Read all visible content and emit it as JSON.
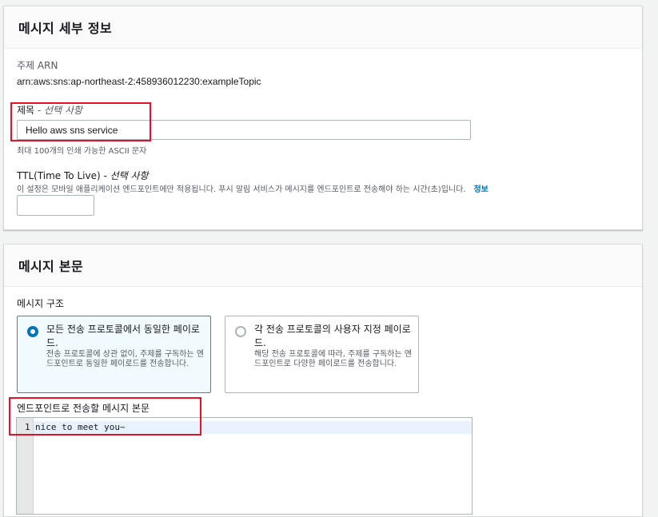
{
  "details": {
    "title": "메시지 세부 정보",
    "topic_arn_label": "주제 ARN",
    "topic_arn_value": "arn:aws:sns:ap-northeast-2:458936012230:exampleTopic",
    "subject_label": "제목",
    "subject_optional": " - 선택 사항",
    "subject_value": "Hello aws sns service",
    "subject_hint": "최대 100개의 인쇄 가능한 ASCII 문자",
    "ttl_label": "TTL(Time To Live)",
    "ttl_optional": " - 선택 사항",
    "ttl_description": "이 설정은 모바일 애플리케이션 엔드포인트에만 적용됩니다. 푸시 알림 서비스가 메시지를 엔드포인트로 전송해야 하는 시간(초)입니다.",
    "ttl_info_link": "정보",
    "ttl_value": ""
  },
  "body": {
    "title": "메시지 본문",
    "structure_label": "메시지 구조",
    "options": [
      {
        "title": "모든 전송 프로토콜에서 동일한 페이로드.",
        "description": "전송 프로토콜에 상관 없이, 주제를 구독하는 엔드포인트로 동일한 페이로드를 전송합니다.",
        "selected": true
      },
      {
        "title": "각 전송 프로토콜의 사용자 지정 페이로드.",
        "description": "해당 전송 프로토콜에 따라, 주제를 구독하는 엔드포인트로 다양한 페이로드를 전송합니다.",
        "selected": false
      }
    ],
    "editor_label": "엔드포인트로 전송할 메시지 본문",
    "editor_line_number": "1",
    "editor_content": "nice to meet you~"
  },
  "colors": {
    "accent": "#0073bb",
    "highlight": "#e81123",
    "selected_tile_border": "#00a1c9"
  }
}
